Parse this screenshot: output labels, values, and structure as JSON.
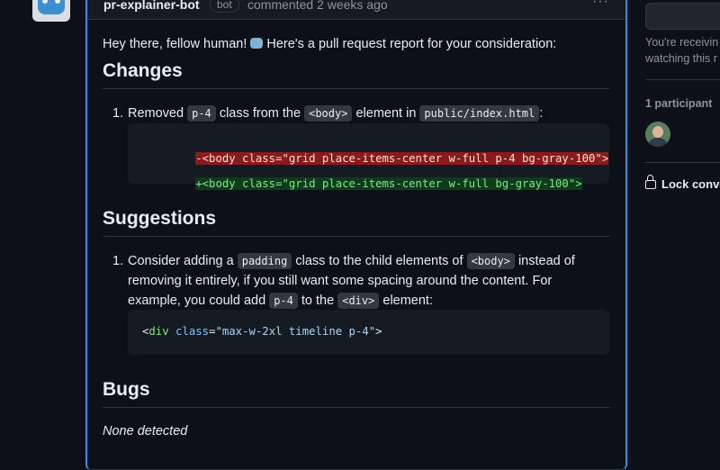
{
  "comment": {
    "author": "pr-explainer-bot",
    "badge": "bot",
    "timestamp": "commented 2 weeks ago",
    "menu_icon": "···"
  },
  "body": {
    "greeting": {
      "before": "Hey there, fellow human!",
      "after": "Here's a pull request report for your consideration:",
      "emoji": "robot-face"
    },
    "changes": {
      "heading": "Changes",
      "item1": {
        "number": "1.",
        "t1": "Removed",
        "code1": "p-4",
        "t2": "class from the",
        "code2": "<body>",
        "t3": "element in",
        "code3": "public/index.html",
        "t4": ":"
      },
      "diff": {
        "removed": "-<body class=\"grid place-items-center w-full p-4 bg-gray-100\">",
        "added": "+<body class=\"grid place-items-center w-full bg-gray-100\">"
      }
    },
    "suggestions": {
      "heading": "Suggestions",
      "item1": {
        "number": "1.",
        "t1": "Consider adding a",
        "code1": "padding",
        "t2": "class to the child elements of",
        "code2": "<body>",
        "t3": "instead of",
        "line2": "removing it entirely, if you still want some spacing around the content. For",
        "t4": "example, you could add",
        "code3": "p-4",
        "t5": "to the",
        "code4": "<div>",
        "t6": "element:"
      },
      "code": {
        "lt": "<",
        "tag": "div",
        "attr": "class",
        "eq": "=",
        "value": "\"max-w-2xl timeline p-4\"",
        "gt": ">"
      }
    },
    "bugs": {
      "heading": "Bugs",
      "text": "None detected"
    }
  },
  "sidebar": {
    "notification_note_1": "You're receivin",
    "notification_note_2": "watching this r",
    "participants_title": "1 participant",
    "lock_label": "Lock conve"
  },
  "colors": {
    "accent": "#388bfd",
    "bg": "#0d1117",
    "diff_removed": "#8b1a1a",
    "diff_added": "#7ee787"
  }
}
